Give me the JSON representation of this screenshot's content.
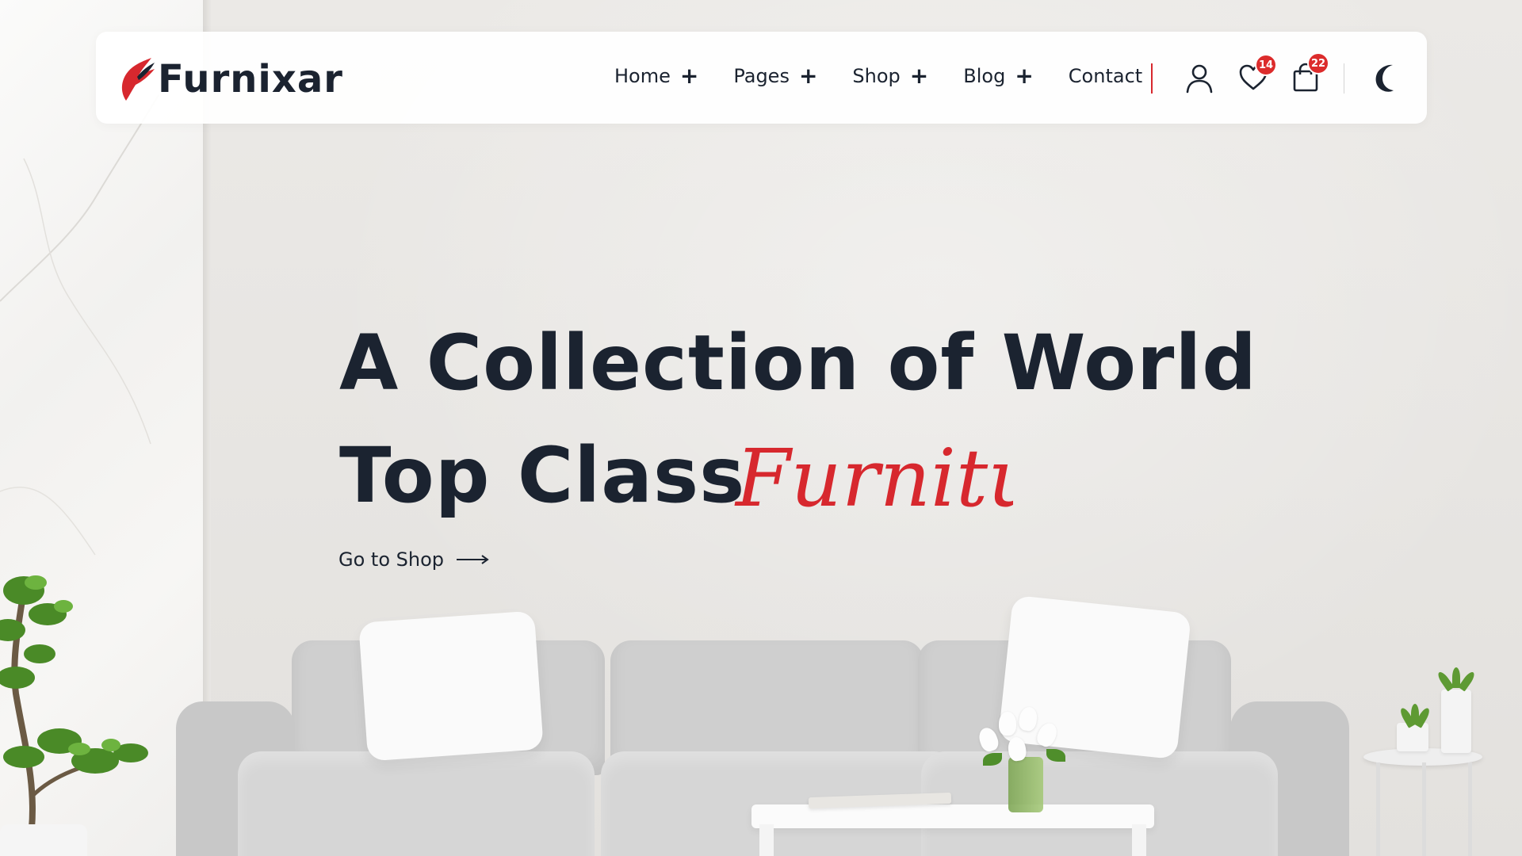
{
  "brand": {
    "name": "Furnixar",
    "accent": "#d7282e",
    "text": "#1b2330"
  },
  "nav": {
    "items": [
      {
        "label": "Home",
        "expand": "+"
      },
      {
        "label": "Pages",
        "expand": "+"
      },
      {
        "label": "Shop",
        "expand": "+"
      },
      {
        "label": "Blog",
        "expand": "+"
      },
      {
        "label": "Contact"
      }
    ]
  },
  "header_icons": {
    "account": "user-icon",
    "wishlist": {
      "icon": "heart-icon",
      "count": "14"
    },
    "cart": {
      "icon": "shopping-bag-icon",
      "count": "22"
    },
    "theme": "moon-icon"
  },
  "hero": {
    "line1": "A Collection of World",
    "line2": "Top Class",
    "script_word": "Furniture",
    "cta_label": "Go to Shop"
  }
}
